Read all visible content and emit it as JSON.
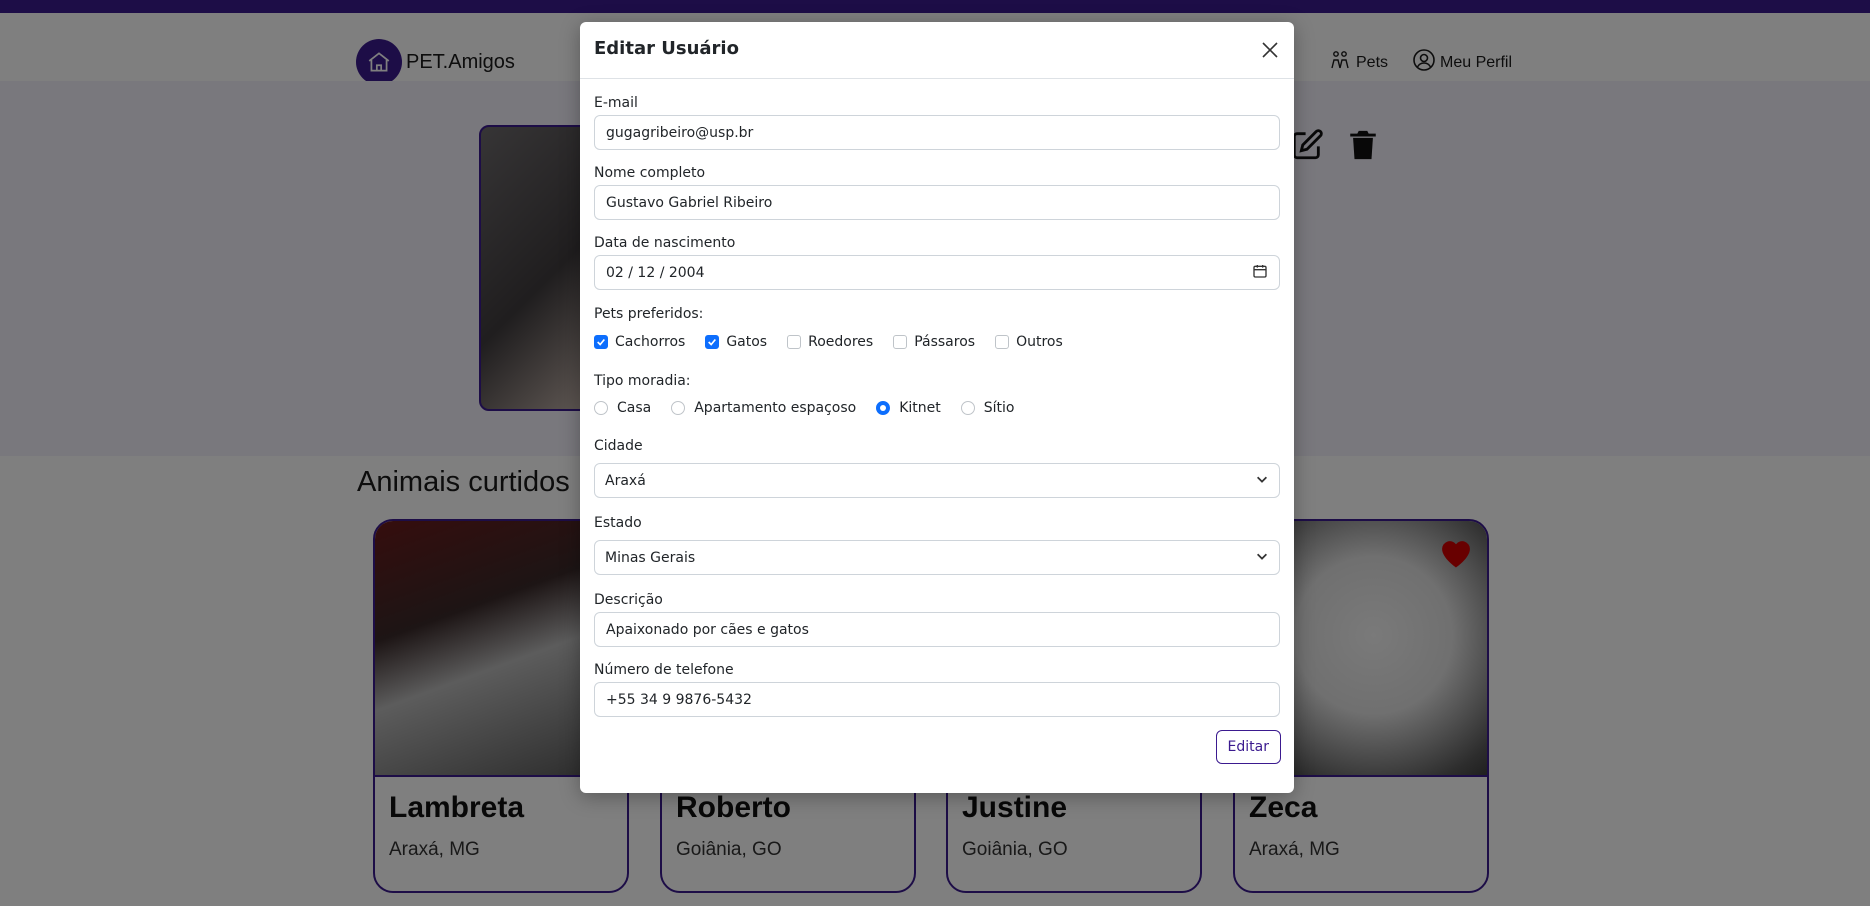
{
  "app": {
    "brand": "PET.Amigos",
    "nav": [
      {
        "label": "Pets",
        "icon": "paw-people-icon"
      },
      {
        "label": "Meu Perfil",
        "icon": "user-circle-icon"
      }
    ]
  },
  "profile": {
    "section_title": "Animais curtidos"
  },
  "pets": [
    {
      "name": "Lambreta",
      "city": "Araxá, MG"
    },
    {
      "name": "Roberto",
      "city": "Goiânia, GO"
    },
    {
      "name": "Justine",
      "city": "Goiânia, GO"
    },
    {
      "name": "Zeca",
      "city": "Araxá, MG"
    }
  ],
  "modal": {
    "title": "Editar Usuário",
    "fields": {
      "email": {
        "label": "E-mail",
        "value": "gugagribeiro@usp.br"
      },
      "name": {
        "label": "Nome completo",
        "value": "Gustavo Gabriel Ribeiro"
      },
      "birth": {
        "label": "Data de nascimento",
        "value": "02 / 12 / 2004"
      },
      "pets_label": "Pets preferidos:",
      "pets_options": [
        {
          "label": "Cachorros",
          "checked": true
        },
        {
          "label": "Gatos",
          "checked": true
        },
        {
          "label": "Roedores",
          "checked": false
        },
        {
          "label": "Pássaros",
          "checked": false
        },
        {
          "label": "Outros",
          "checked": false
        }
      ],
      "housing_label": "Tipo moradia:",
      "housing_options": [
        {
          "label": "Casa",
          "checked": false
        },
        {
          "label": "Apartamento espaçoso",
          "checked": false
        },
        {
          "label": "Kitnet",
          "checked": true
        },
        {
          "label": "Sítio",
          "checked": false
        }
      ],
      "city": {
        "label": "Cidade",
        "value": "Araxá"
      },
      "state": {
        "label": "Estado",
        "value": "Minas Gerais"
      },
      "description": {
        "label": "Descrição",
        "value": "Apaixonado por cães e gatos"
      },
      "phone": {
        "label": "Número de telefone",
        "value": "+55 34 9 9876-5432"
      }
    },
    "submit_label": "Editar"
  },
  "colors": {
    "brand": "#3b1a8f",
    "checked": "#0d6efd",
    "heart": "#d10000"
  }
}
